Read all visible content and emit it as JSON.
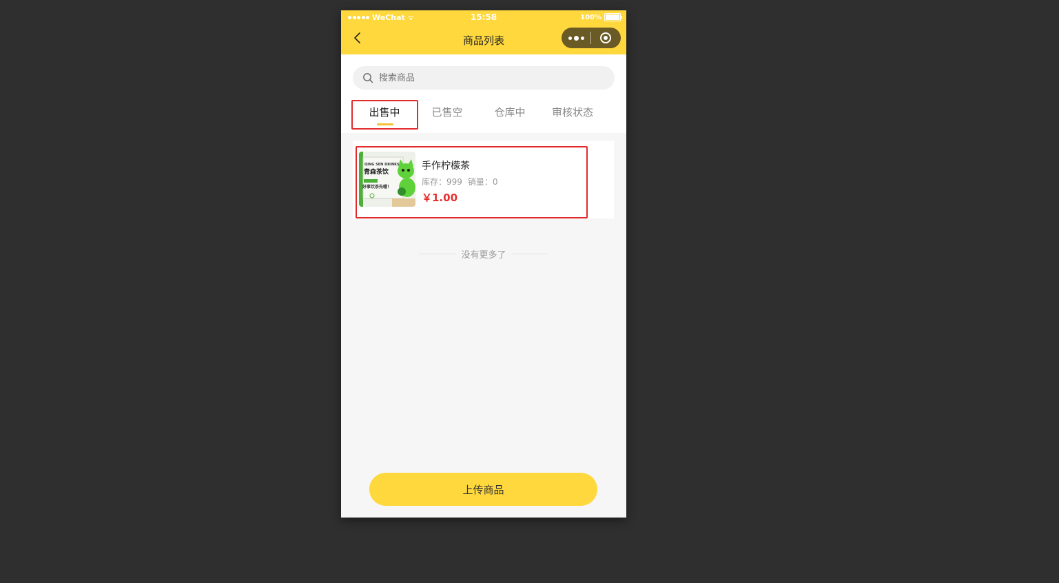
{
  "status_bar": {
    "carrier": "WeChat",
    "time": "15:58",
    "battery": "100%"
  },
  "nav": {
    "title": "商品列表"
  },
  "search": {
    "placeholder": "搜索商品"
  },
  "tabs": [
    {
      "label": "出售中",
      "active": true
    },
    {
      "label": "已售空",
      "active": false
    },
    {
      "label": "仓库中",
      "active": false
    },
    {
      "label": "审核状态",
      "active": false
    }
  ],
  "products": [
    {
      "name": "手作柠檬茶",
      "stock_label": "库存：999",
      "sales_label": "销量：0",
      "price": "￥1.00",
      "image_text": {
        "brand": "QING SEN DRINKS",
        "title": "青森茶饮",
        "slogan": "好事饮茶先喔！"
      }
    }
  ],
  "list_end_text": "没有更多了",
  "upload_button_label": "上传商品",
  "colors": {
    "nav_bg": "#ffd83d",
    "accent": "#f1c232",
    "price": "#e82f2f",
    "highlight": "#e12b2b"
  }
}
